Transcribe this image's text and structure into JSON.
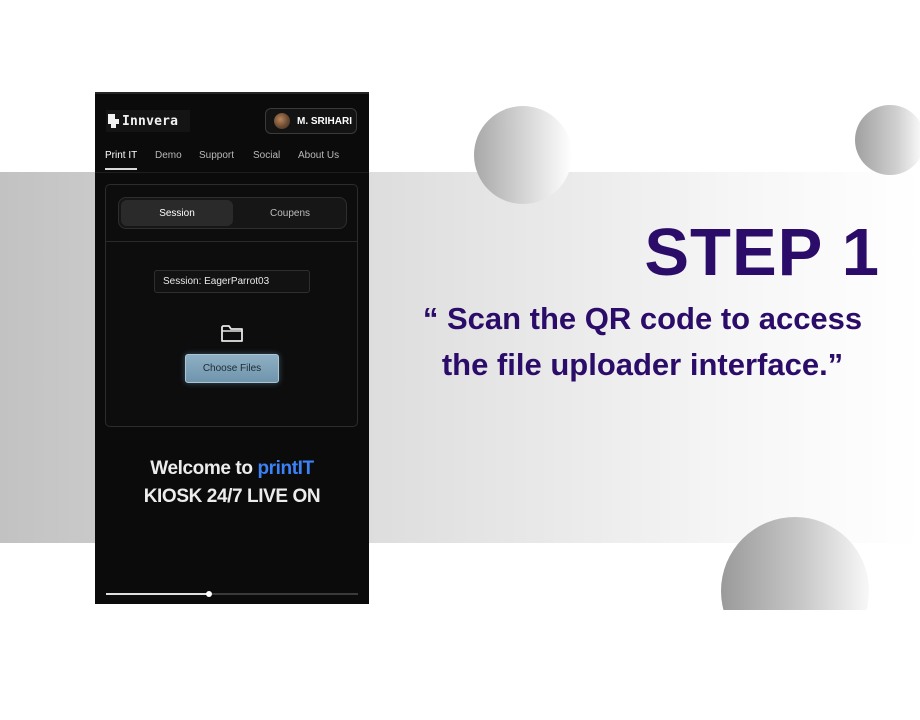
{
  "phone": {
    "logo_text": "Innvera",
    "user_name": "M. SRIHARI",
    "nav": [
      "Print IT",
      "Demo",
      "Support",
      "Social",
      "About Us"
    ],
    "tabs": [
      "Session",
      "Coupens"
    ],
    "session_field": "Session: EagerParrot03",
    "choose_files_label": "Choose Files",
    "welcome_prefix": "Welcome to ",
    "welcome_brand": "printIT",
    "kiosk_line": "KIOSK 24/7 LIVE ON",
    "scroll_progress": 0.41,
    "colors": {
      "brand_blue": "#3b82f6",
      "button": "#7fa2b8"
    },
    "icons": [
      "user-avatar",
      "folder-icon"
    ]
  },
  "slide": {
    "step_title": "STEP 1",
    "description_line1": "“ Scan the QR code to access",
    "description_line2": "the file uploader interface.”",
    "colors": {
      "title": "#2b0c68"
    }
  }
}
